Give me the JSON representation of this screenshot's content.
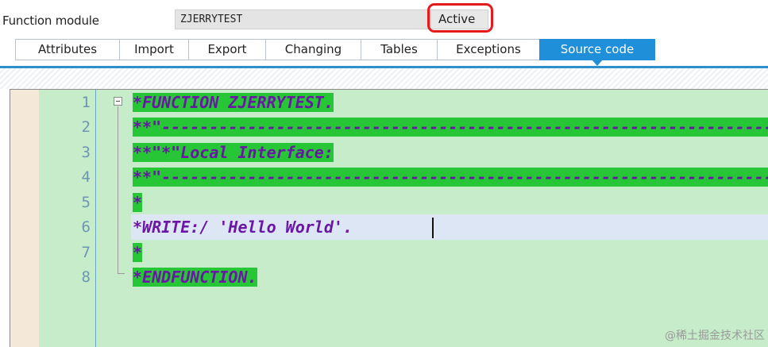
{
  "header": {
    "function_module_label": "Function module",
    "function_module_name": "ZJERRYTEST",
    "status": "Active",
    "status_highlight_color": "#e51b1b"
  },
  "tabs": [
    {
      "label": "Attributes",
      "active": false
    },
    {
      "label": "Import",
      "active": false
    },
    {
      "label": "Export",
      "active": false
    },
    {
      "label": "Changing",
      "active": false
    },
    {
      "label": "Tables",
      "active": false
    },
    {
      "label": "Exceptions",
      "active": false
    },
    {
      "label": "Source code",
      "active": true
    }
  ],
  "editor": {
    "line_numbers": [
      "1",
      "2",
      "3",
      "4",
      "5",
      "6",
      "7",
      "8"
    ],
    "lines": [
      "*FUNCTION ZJERRYTEST.",
      "**\"----------------------------------------------------------------------",
      "**\"*\"Local Interface:",
      "**\"----------------------------------------------------------------------",
      "*",
      "*WRITE:/ 'Hello World'.",
      "*",
      "*ENDFUNCTION."
    ],
    "current_line": 6,
    "comment_color": "#6a17a4",
    "highlight_color": "#26c636",
    "background_color": "#c6ecc9"
  },
  "watermark": "@稀土掘金技术社区"
}
